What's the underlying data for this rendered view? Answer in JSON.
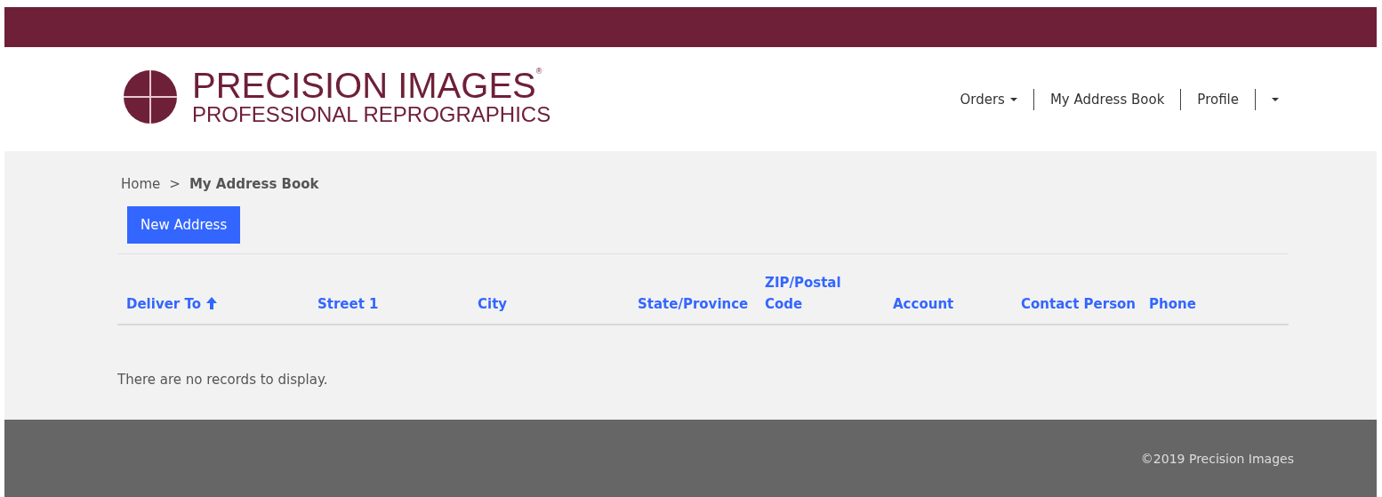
{
  "logo": {
    "title": "PRECISION IMAGES",
    "mark": "®",
    "subtitle": "PROFESSIONAL REPROGRAPHICS"
  },
  "nav": [
    {
      "label": "Orders",
      "dropdown": true
    },
    {
      "label": "My Address Book",
      "dropdown": false
    },
    {
      "label": "Profile",
      "dropdown": false
    },
    {
      "dropdown": true
    }
  ],
  "breadcrumb": [
    {
      "label": "Home",
      "current": false
    },
    {
      "label": "My Address Book",
      "current": true
    }
  ],
  "breadcrumb_separator": ">",
  "new_button": "New Address",
  "table": {
    "columns": [
      {
        "label": "Deliver To",
        "sorted": true
      },
      {
        "label": "Street 1",
        "sorted": false
      },
      {
        "label": "City",
        "sorted": false
      },
      {
        "label": "State/Province",
        "sorted": false
      },
      {
        "label": "ZIP/Postal Code",
        "sorted": false
      },
      {
        "label": "Account",
        "sorted": false
      },
      {
        "label": "Contact Person",
        "sorted": false
      },
      {
        "label": "Phone",
        "sorted": false
      }
    ],
    "empty_message": "There are no records to display."
  },
  "footer": "©2019 Precision Images"
}
